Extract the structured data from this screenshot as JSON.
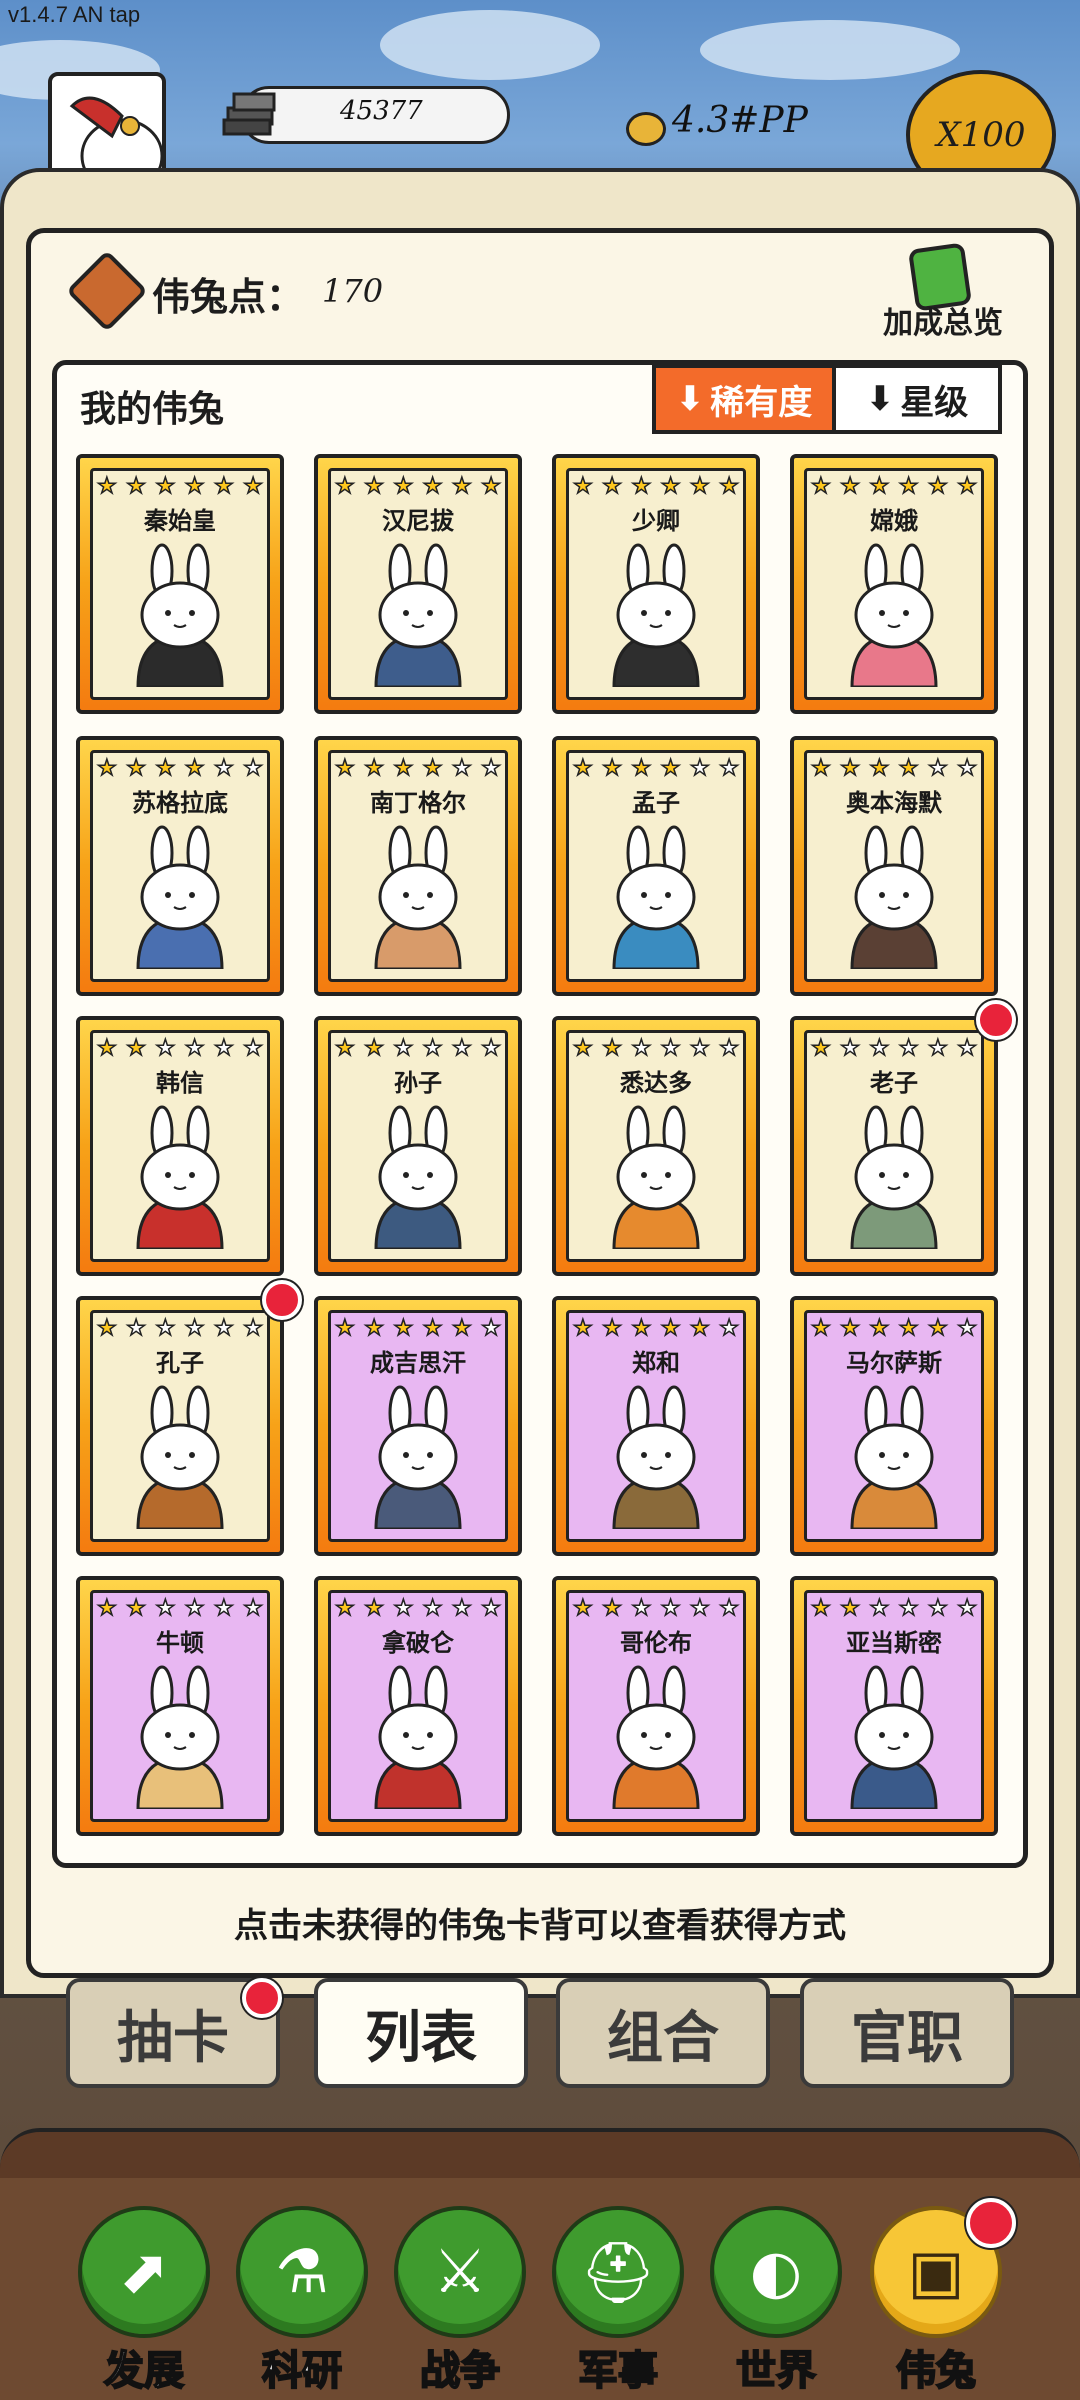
{
  "status": {
    "version": "v1.4.7 AN tap"
  },
  "hud": {
    "stone_value": "45377",
    "coin_value": "4.3#PP",
    "multiplier": "X100"
  },
  "panel": {
    "points_label": "伟兔点：",
    "points_value": "170",
    "bonus_label": "加成总览",
    "list_title": "我的伟兔",
    "sort_rarity": "稀有度",
    "sort_star": "星级",
    "hint": "点击未获得的伟兔卡背可以查看获得方式"
  },
  "cards": [
    {
      "name": "秦始皇",
      "stars": 6,
      "rarity": "gold",
      "badge": false,
      "color": "#2b2b2b"
    },
    {
      "name": "汉尼拔",
      "stars": 6,
      "rarity": "gold",
      "badge": false,
      "color": "#3e5d8c"
    },
    {
      "name": "少卿",
      "stars": 6,
      "rarity": "gold",
      "badge": false,
      "color": "#2e2e2e"
    },
    {
      "name": "嫦娥",
      "stars": 6,
      "rarity": "gold",
      "badge": false,
      "color": "#e8788a"
    },
    {
      "name": "苏格拉底",
      "stars": 4,
      "rarity": "gold",
      "badge": false,
      "color": "#4a6fb0"
    },
    {
      "name": "南丁格尔",
      "stars": 4,
      "rarity": "gold",
      "badge": false,
      "color": "#d89b6a"
    },
    {
      "name": "孟子",
      "stars": 4,
      "rarity": "gold",
      "badge": false,
      "color": "#3a8cc0"
    },
    {
      "name": "奥本海默",
      "stars": 4,
      "rarity": "gold",
      "badge": false,
      "color": "#5a4034"
    },
    {
      "name": "韩信",
      "stars": 2,
      "rarity": "gold",
      "badge": false,
      "color": "#c8302c"
    },
    {
      "name": "孙子",
      "stars": 2,
      "rarity": "gold",
      "badge": false,
      "color": "#3d5a80"
    },
    {
      "name": "悉达多",
      "stars": 2,
      "rarity": "gold",
      "badge": false,
      "color": "#e68a2e"
    },
    {
      "name": "老子",
      "stars": 1,
      "rarity": "gold",
      "badge": true,
      "color": "#7d9a7a"
    },
    {
      "name": "孔子",
      "stars": 1,
      "rarity": "gold",
      "badge": true,
      "color": "#b56a2c"
    },
    {
      "name": "成吉思汗",
      "stars": 5,
      "rarity": "purple",
      "badge": false,
      "color": "#4a5a7a"
    },
    {
      "name": "郑和",
      "stars": 5,
      "rarity": "purple",
      "badge": false,
      "color": "#8a6a3a"
    },
    {
      "name": "马尔萨斯",
      "stars": 5,
      "rarity": "purple",
      "badge": false,
      "color": "#d98a3a"
    },
    {
      "name": "牛顿",
      "stars": 2,
      "rarity": "purple",
      "badge": false,
      "color": "#e8c07a"
    },
    {
      "name": "拿破仑",
      "stars": 2,
      "rarity": "purple",
      "badge": false,
      "color": "#c0322c"
    },
    {
      "name": "哥伦布",
      "stars": 2,
      "rarity": "purple",
      "badge": false,
      "color": "#e07a2c"
    },
    {
      "name": "亚当斯密",
      "stars": 2,
      "rarity": "purple",
      "badge": false,
      "color": "#3a5a8a"
    }
  ],
  "tabs": [
    {
      "label": "抽卡",
      "active": false,
      "badge": true
    },
    {
      "label": "列表",
      "active": true,
      "badge": false
    },
    {
      "label": "组合",
      "active": false,
      "badge": false
    },
    {
      "label": "官职",
      "active": false,
      "badge": false
    }
  ],
  "nav": [
    {
      "label": "发展",
      "icon": "arrow-up-icon",
      "glyph": "⬈",
      "active": false,
      "badge": false
    },
    {
      "label": "科研",
      "icon": "flask-icon",
      "glyph": "⚗",
      "active": false,
      "badge": false
    },
    {
      "label": "战争",
      "icon": "crossed-swords-icon",
      "glyph": "⚔",
      "active": false,
      "badge": false
    },
    {
      "label": "军事",
      "icon": "helmet-icon",
      "glyph": "⛑",
      "active": false,
      "badge": false
    },
    {
      "label": "世界",
      "icon": "globe-icon",
      "glyph": "◐",
      "active": false,
      "badge": false
    },
    {
      "label": "伟兔",
      "icon": "bunny-card-icon",
      "glyph": "▣",
      "active": true,
      "badge": true
    }
  ]
}
